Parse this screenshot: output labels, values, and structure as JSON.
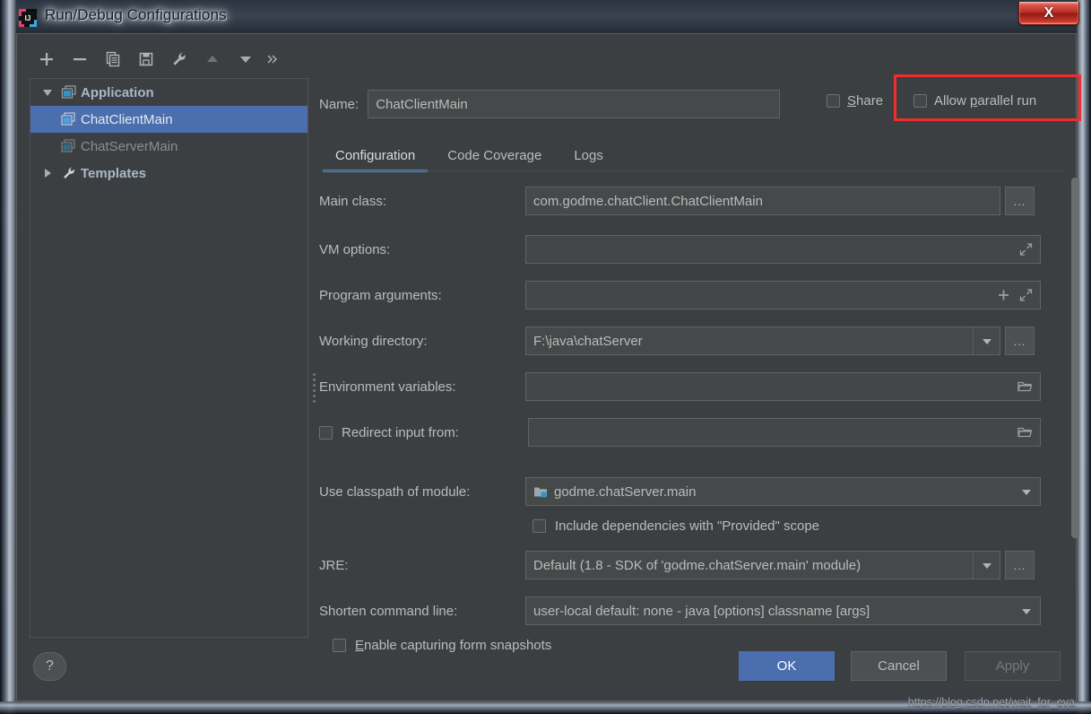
{
  "window": {
    "title": "Run/Debug Configurations",
    "icon": "intellij-idea-icon",
    "close_label": "X"
  },
  "left_panel": {
    "toolbar": [
      {
        "name": "add-configuration-button",
        "icon": "plus-icon",
        "label": "+"
      },
      {
        "name": "remove-configuration-button",
        "icon": "minus-icon",
        "label": "−"
      },
      {
        "name": "copy-configuration-button",
        "icon": "copy-icon",
        "label": "Copy"
      },
      {
        "name": "save-configuration-button",
        "icon": "save-icon",
        "label": "Save"
      },
      {
        "name": "edit-templates-button",
        "icon": "wrench-icon",
        "label": "Templates"
      },
      {
        "name": "move-up-button",
        "icon": "arrow-up-icon",
        "label": "Move Up"
      },
      {
        "name": "move-down-button",
        "icon": "arrow-down-icon",
        "label": "Move Down"
      },
      {
        "name": "more-options-button",
        "icon": "chevron-double-right-icon",
        "label": "»"
      }
    ],
    "tree": [
      {
        "label": "Application",
        "icon": "application-folder-icon",
        "twisty": "expanded",
        "level": 0,
        "selected": false,
        "dim": false
      },
      {
        "label": "ChatClientMain",
        "icon": "application-config-icon",
        "twisty": "none",
        "level": 1,
        "selected": true,
        "dim": false
      },
      {
        "label": "ChatServerMain",
        "icon": "application-config-icon",
        "twisty": "none",
        "level": 1,
        "selected": false,
        "dim": true
      },
      {
        "label": "Templates",
        "icon": "wrench-icon",
        "twisty": "collapsed",
        "level": 0,
        "selected": false,
        "dim": false
      }
    ]
  },
  "header": {
    "name_label": "Name:",
    "name_value": "ChatClientMain",
    "share": {
      "label": "Share",
      "mnemonic": "S",
      "checked": false
    },
    "parallel": {
      "label_before": "Allow ",
      "mnemonic": "p",
      "label_after": "arallel run",
      "full_label": "Allow parallel run",
      "checked": false
    },
    "highlight_color": "#ef2d2d"
  },
  "tabs": [
    {
      "label": "Configuration",
      "active": true
    },
    {
      "label": "Code Coverage",
      "active": false
    },
    {
      "label": "Logs",
      "active": false
    }
  ],
  "form": {
    "main_class": {
      "label": "Main class:",
      "value": "com.godme.chatClient.ChatClientMain",
      "browse": "..."
    },
    "vm_options": {
      "label": "VM options:",
      "value": "",
      "expand_icon": "expand-diagonal-icon"
    },
    "program_arguments": {
      "label": "Program arguments:",
      "value": "",
      "add_icon": "plus-icon",
      "expand_icon": "expand-diagonal-icon"
    },
    "working_directory": {
      "label": "Working directory:",
      "value": "F:\\java\\chatServer",
      "browse": "..."
    },
    "environment_variables": {
      "label": "Environment variables:",
      "value": "",
      "folder_icon": "folder-icon"
    },
    "redirect_input": {
      "label": "Redirect input from:",
      "value": "",
      "checked": false,
      "folder_icon": "folder-icon"
    },
    "classpath_module": {
      "label": "Use classpath of module:",
      "value": "godme.chatServer.main",
      "icon": "module-icon"
    },
    "include_provided": {
      "label": "Include dependencies with \"Provided\" scope",
      "checked": false
    },
    "jre": {
      "label": "JRE:",
      "value": "Default (1.8 - SDK of 'godme.chatServer.main' module)",
      "browse": "..."
    },
    "shorten_command_line": {
      "label": "Shorten command line:",
      "value": "user-local default: none - java [options] classname [args]"
    },
    "form_snapshots": {
      "label_before": "",
      "mnemonic": "E",
      "label_after": "nable capturing form snapshots",
      "full_label": "Enable capturing form snapshots",
      "checked": false
    }
  },
  "footer": {
    "help": "?",
    "ok": "OK",
    "cancel": "Cancel",
    "apply": "Apply"
  },
  "watermark": "https://blog.csdn.net/wait_for_eva"
}
